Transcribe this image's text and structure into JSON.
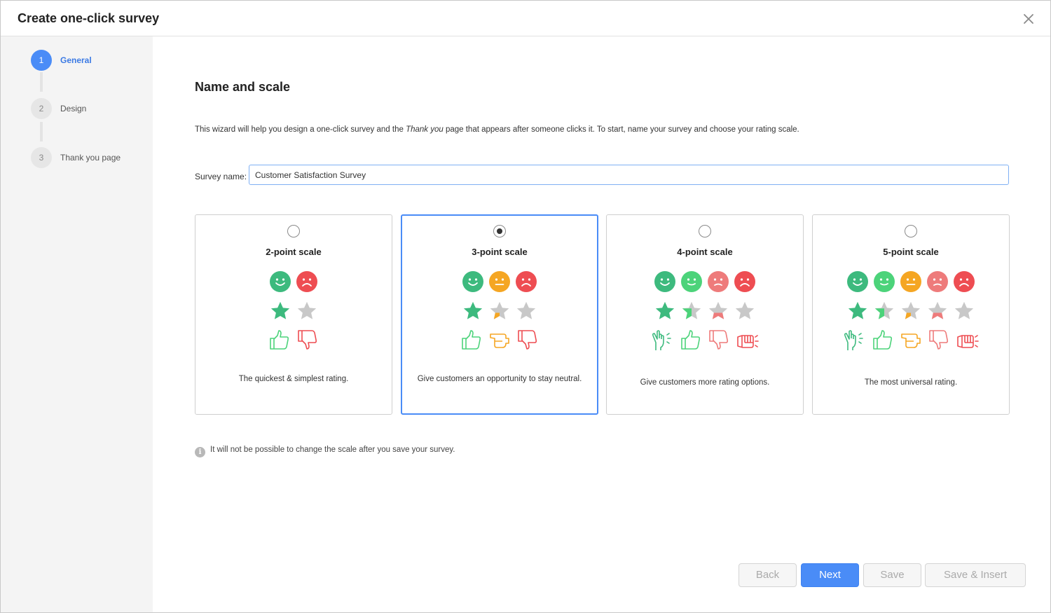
{
  "dialog": {
    "title": "Create one-click survey",
    "close_icon": "close-icon"
  },
  "steps": [
    {
      "number": "1",
      "label": "General",
      "active": true
    },
    {
      "number": "2",
      "label": "Design",
      "active": false
    },
    {
      "number": "3",
      "label": "Thank you page",
      "active": false
    }
  ],
  "main": {
    "section_title": "Name and scale",
    "intro_before": "This wizard will help you design a one-click survey and the ",
    "intro_em": "Thank you",
    "intro_after": " page that appears after someone clicks it. To start, name your survey and choose your rating scale.",
    "survey_name_label": "Survey name:",
    "survey_name_value": "Customer Satisfaction Survey",
    "note": "It will not be possible to change the scale after you save your survey.",
    "info_icon": "info-icon"
  },
  "scales": [
    {
      "title": "2-point scale",
      "description": "The quickest & simplest rating.",
      "selected": false
    },
    {
      "title": "3-point scale",
      "description": "Give customers an opportunity to stay neutral.",
      "selected": true
    },
    {
      "title": "4-point scale",
      "description": "Give customers more rating options.",
      "selected": false
    },
    {
      "title": "5-point scale",
      "description": "The most universal rating.",
      "selected": false
    }
  ],
  "footer": {
    "back_label": "Back",
    "next_label": "Next",
    "save_label": "Save",
    "save_insert_label": "Save & Insert"
  },
  "colors": {
    "accent": "#4a8cf7",
    "green_dark": "#3dba7e",
    "green_light": "#4cd37a",
    "orange": "#f5a623",
    "red_light": "#ee7b7b",
    "red": "#ee4d52",
    "gray_star": "#c8c8c8"
  }
}
